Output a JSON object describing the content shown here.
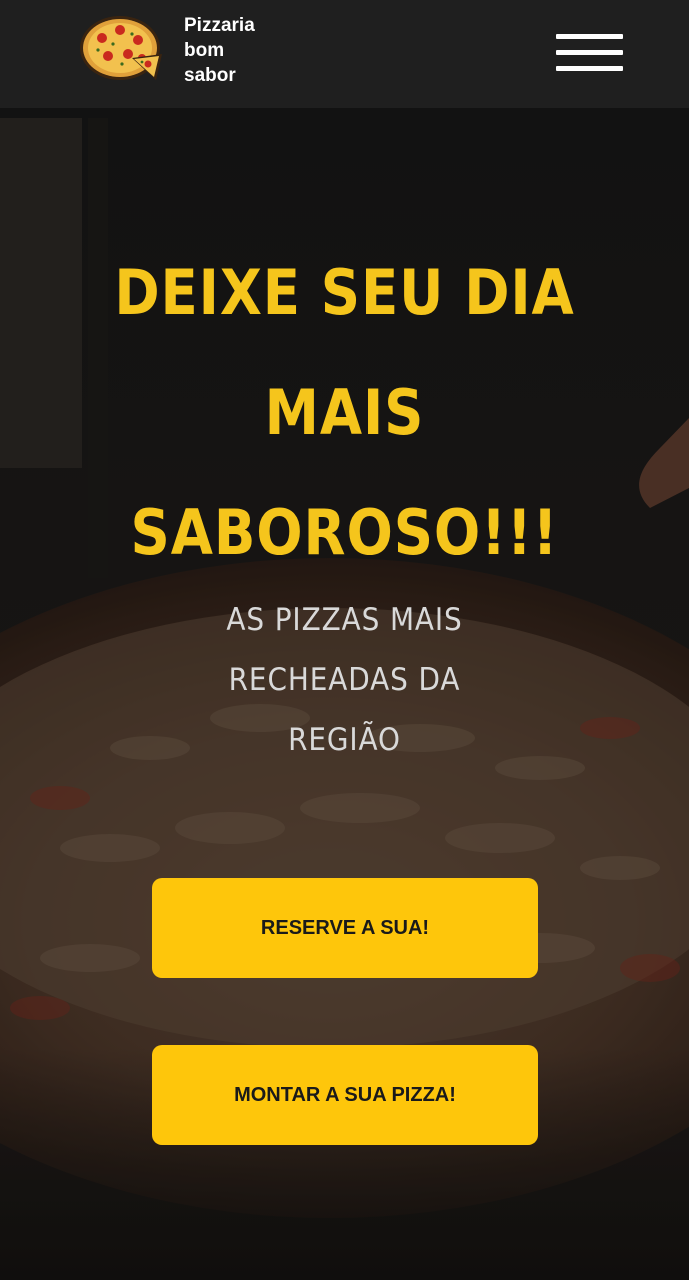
{
  "header": {
    "brand_line1": "Pizzaria",
    "brand_line2": "bom",
    "brand_line3": "sabor",
    "logo_icon": "pizza-logo-icon",
    "menu_icon": "hamburger-menu-icon",
    "background_color": "#1f1f1f"
  },
  "hero": {
    "title_line1": "DEIXE SEU DIA",
    "title_line2": "MAIS",
    "title_line3": "SABOROSO!!!",
    "subtitle_line1": "AS PIZZAS MAIS",
    "subtitle_line2": "RECHEADAS DA",
    "subtitle_line3": "REGIÃO",
    "title_color": "#f5c51c",
    "subtitle_color": "#d9d9d9"
  },
  "buttons": {
    "reserve_label": "RESERVE A SUA!",
    "build_label": "MONTAR A SUA PIZZA!",
    "background_color": "#fec60b"
  }
}
